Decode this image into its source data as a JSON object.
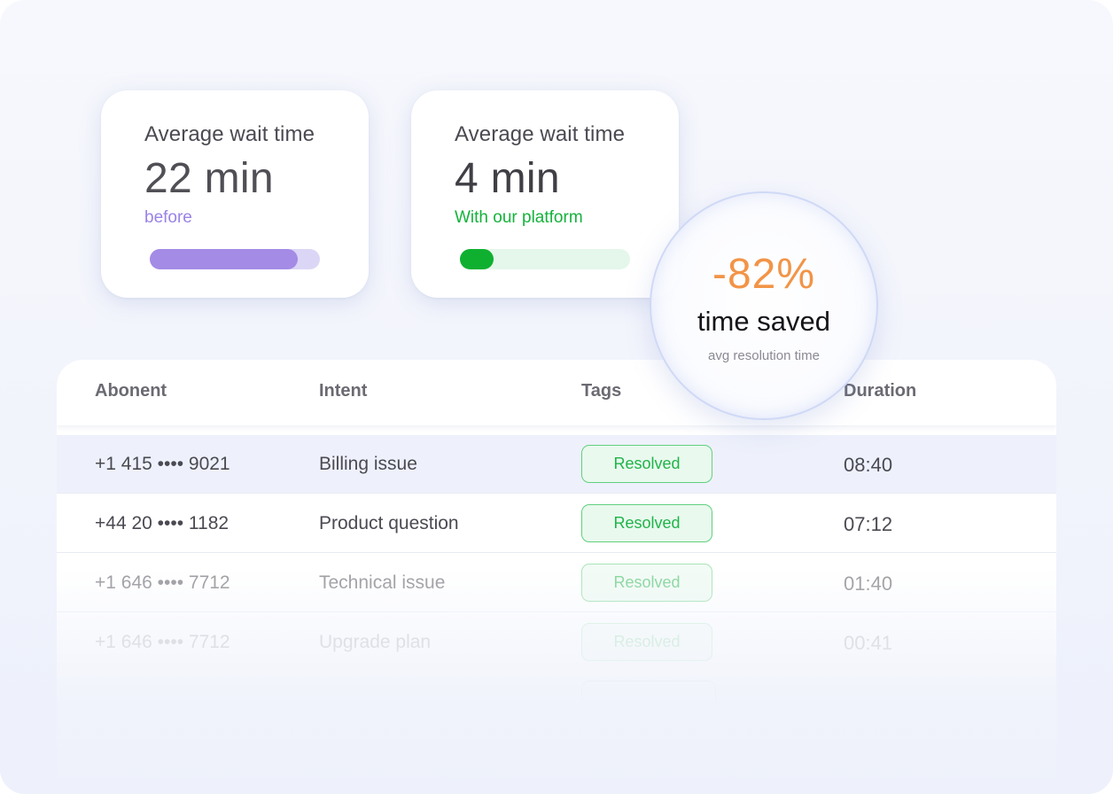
{
  "cards": {
    "before": {
      "title": "Average wait time",
      "value": "22 min",
      "subtitle": "before",
      "progress": 0.87
    },
    "after": {
      "title": "Average wait time",
      "value": "4 min",
      "subtitle": "With our platform",
      "progress": 0.2
    }
  },
  "lens": {
    "percent": "-82%",
    "label": "time saved",
    "note": "avg resolution time"
  },
  "table": {
    "headers": {
      "abonent": "Abonent",
      "intent": "Intent",
      "tags": "Tags",
      "duration": "Duration"
    },
    "rows": [
      {
        "abonent": "+1 415 •••• 9021",
        "intent": "Billing issue",
        "tag": "Resolved",
        "duration": "08:40"
      },
      {
        "abonent": "+44 20 •••• 1182",
        "intent": "Product question",
        "tag": "Resolved",
        "duration": "07:12"
      },
      {
        "abonent": "+1 646 •••• 7712",
        "intent": "Technical issue",
        "tag": "Resolved",
        "duration": "01:40"
      },
      {
        "abonent": "+1 646 •••• 7712",
        "intent": "Upgrade plan",
        "tag": "Resolved",
        "duration": "00:41"
      }
    ]
  },
  "colors": {
    "before_accent": "#a48be6",
    "after_accent": "#0fb030",
    "percent": "#f29447",
    "tag_border": "#62d07f"
  }
}
